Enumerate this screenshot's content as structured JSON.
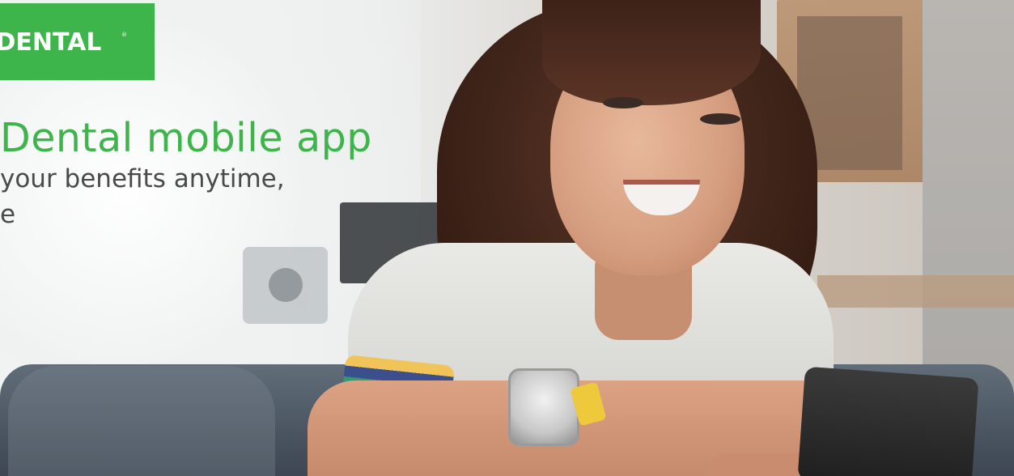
{
  "brand": {
    "logo_text": " DENTAL",
    "logo_registered": "®",
    "accent_color": "#3db54a"
  },
  "hero": {
    "headline": "Dental mobile app",
    "subline_1": "your benefits anytime,",
    "subline_2": "e"
  }
}
